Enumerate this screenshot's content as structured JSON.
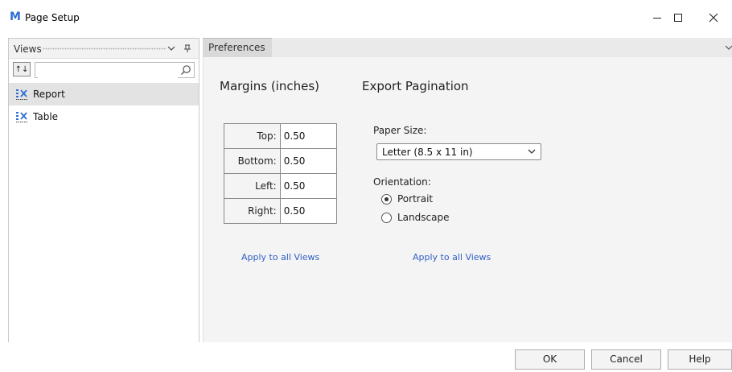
{
  "window": {
    "title": "Page Setup",
    "app_logo": "M"
  },
  "views_panel": {
    "header_label": "Views",
    "search": {
      "value": "",
      "placeholder": ""
    },
    "sort_button_label": "↑↓",
    "items": [
      {
        "label": "Report",
        "icon": "report-view-icon",
        "selected": true
      },
      {
        "label": "Table",
        "icon": "table-view-icon",
        "selected": false
      }
    ]
  },
  "tabs": [
    {
      "label": "Preferences",
      "active": true
    }
  ],
  "margins": {
    "title": "Margins (inches)",
    "rows": [
      {
        "label": "Top:",
        "value": "0.50"
      },
      {
        "label": "Bottom:",
        "value": "0.50"
      },
      {
        "label": "Left:",
        "value": "0.50"
      },
      {
        "label": "Right:",
        "value": "0.50"
      }
    ],
    "apply_link": "Apply to all Views"
  },
  "export": {
    "title": "Export Pagination",
    "paper_size_label": "Paper Size:",
    "paper_size_value": "Letter (8.5 x 11 in)",
    "orientation_label": "Orientation:",
    "orientation_options": [
      {
        "label": "Portrait",
        "checked": true
      },
      {
        "label": "Landscape",
        "checked": false
      }
    ],
    "apply_link": "Apply to all Views"
  },
  "buttons": {
    "ok": "OK",
    "cancel": "Cancel",
    "help": "Help"
  },
  "colors": {
    "accent": "#2f6fd6",
    "link": "#2f5fc6",
    "selected_row": "#e3e3e3",
    "content_background": "#f4f4f4"
  }
}
